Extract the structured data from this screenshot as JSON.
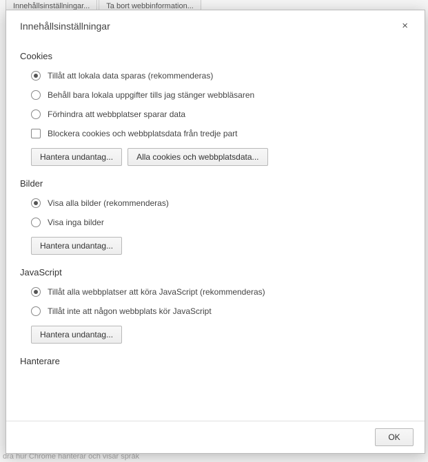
{
  "background": {
    "btn1": "Innehållsinställningar...",
    "btn2": "Ta bort webbinformation...",
    "bottom_text": "dra hur Chrome hanterar och visar språk"
  },
  "dialog": {
    "title": "Innehållsinställningar",
    "ok_label": "OK"
  },
  "sections": {
    "cookies": {
      "title": "Cookies",
      "opt1": "Tillåt att lokala data sparas (rekommenderas)",
      "opt2": "Behåll bara lokala uppgifter tills jag stänger webbläsaren",
      "opt3": "Förhindra att webbplatser sparar data",
      "chk1": "Blockera cookies och webbplatsdata från tredje part",
      "btn1": "Hantera undantag...",
      "btn2": "Alla cookies och webbplatsdata..."
    },
    "images": {
      "title": "Bilder",
      "opt1": "Visa alla bilder (rekommenderas)",
      "opt2": "Visa inga bilder",
      "btn1": "Hantera undantag..."
    },
    "javascript": {
      "title": "JavaScript",
      "opt1": "Tillåt alla webbplatser att köra JavaScript (rekommenderas)",
      "opt2": "Tillåt inte att någon webbplats kör JavaScript",
      "btn1": "Hantera undantag..."
    },
    "handlers": {
      "title": "Hanterare"
    }
  }
}
